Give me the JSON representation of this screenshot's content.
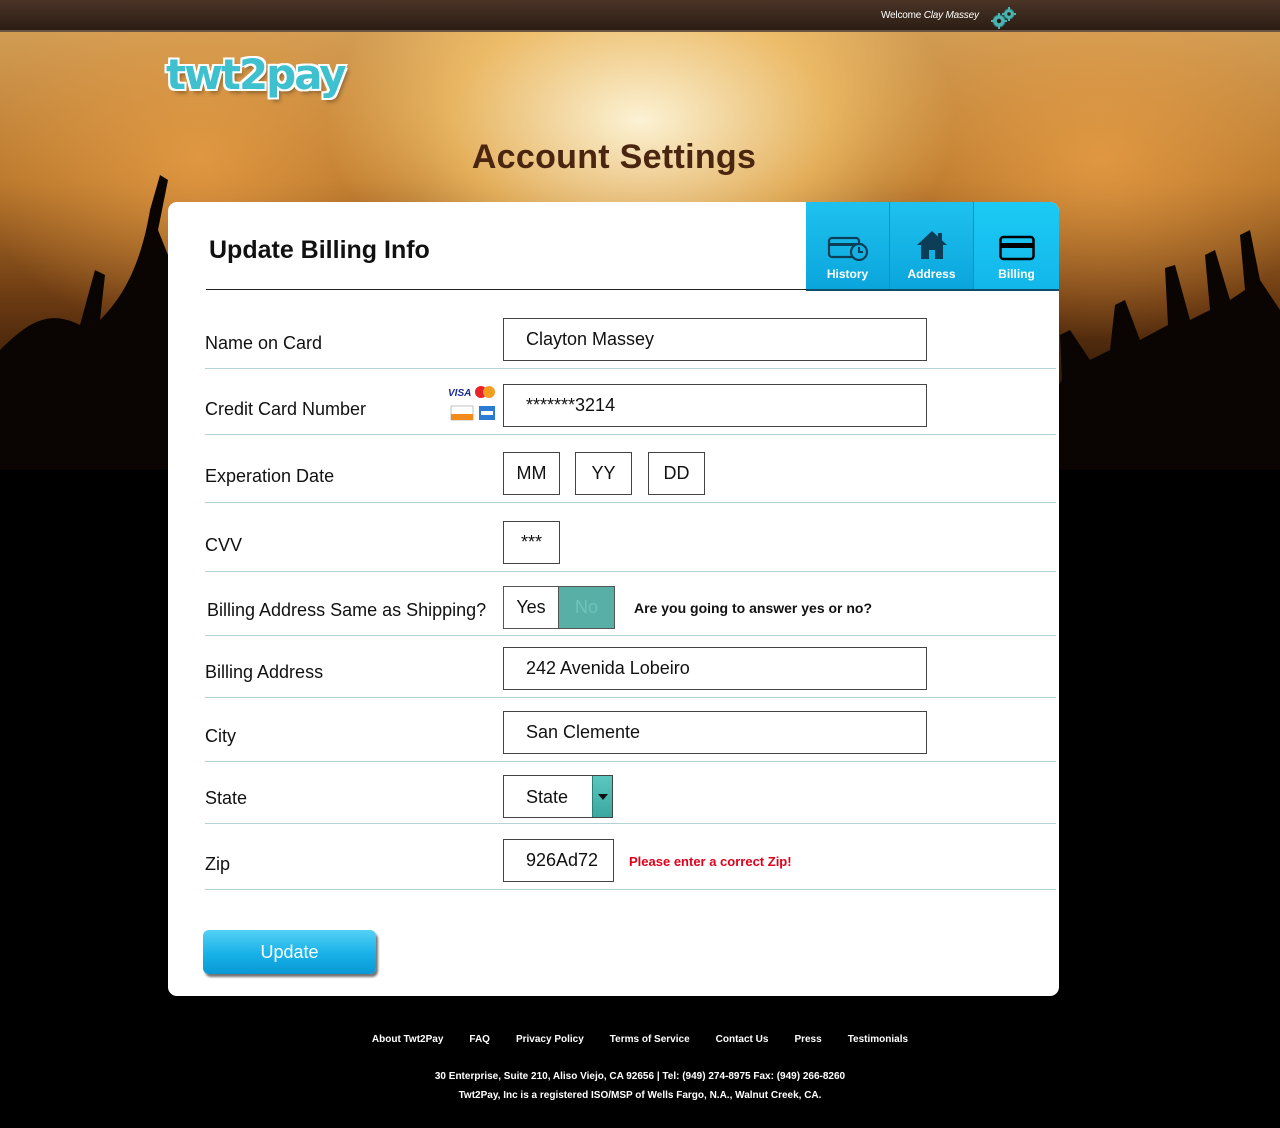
{
  "topbar": {
    "welcome_prefix": "Welcome",
    "user_name": "Clay Massey"
  },
  "brand": {
    "logo_text": "twt2pay"
  },
  "page": {
    "title": "Account Settings"
  },
  "card": {
    "heading": "Update Billing Info"
  },
  "tabs": [
    {
      "label": "History",
      "icon": "card-history-icon"
    },
    {
      "label": "Address",
      "icon": "house-icon"
    },
    {
      "label": "Billing",
      "icon": "credit-card-icon",
      "active": true
    }
  ],
  "form": {
    "name_on_card": {
      "label": "Name on Card",
      "value": "Clayton Massey"
    },
    "card_number": {
      "label": "Credit Card Number",
      "value": "*******3214"
    },
    "expiration": {
      "label": "Experation Date",
      "month": "MM",
      "year": "YY",
      "day": "DD"
    },
    "cvv": {
      "label": "CVV",
      "value": "***"
    },
    "same_as_shipping": {
      "label": "Billing Address Same as Shipping?",
      "yes": "Yes",
      "no": "No",
      "hint": "Are you going to answer yes or no?"
    },
    "billing_address": {
      "label": "Billing Address",
      "value": "242 Avenida Lobeiro"
    },
    "city": {
      "label": "City",
      "value": "San Clemente"
    },
    "state": {
      "label": "State",
      "value": "State"
    },
    "zip": {
      "label": "Zip",
      "value": "926Ad72",
      "error": "Please enter a correct Zip!"
    },
    "submit_label": "Update"
  },
  "footer": {
    "links": [
      "About Twt2Pay",
      "FAQ",
      "Privacy Policy",
      "Terms of Service",
      "Contact Us",
      "Press",
      "Testimonials"
    ],
    "address": "30 Enterprise, Suite 210, Aliso Viejo, CA 92656 | Tel: (949) 274-8975 Fax: (949) 266-8260",
    "legal": "Twt2Pay, Inc is a registered ISO/MSP of Wells Fargo, N.A., Walnut Creek, CA."
  },
  "colors": {
    "accent": "#12b7ea",
    "error": "#e0001b",
    "toggle_no": "#58afa6",
    "title": "#4a2510"
  }
}
